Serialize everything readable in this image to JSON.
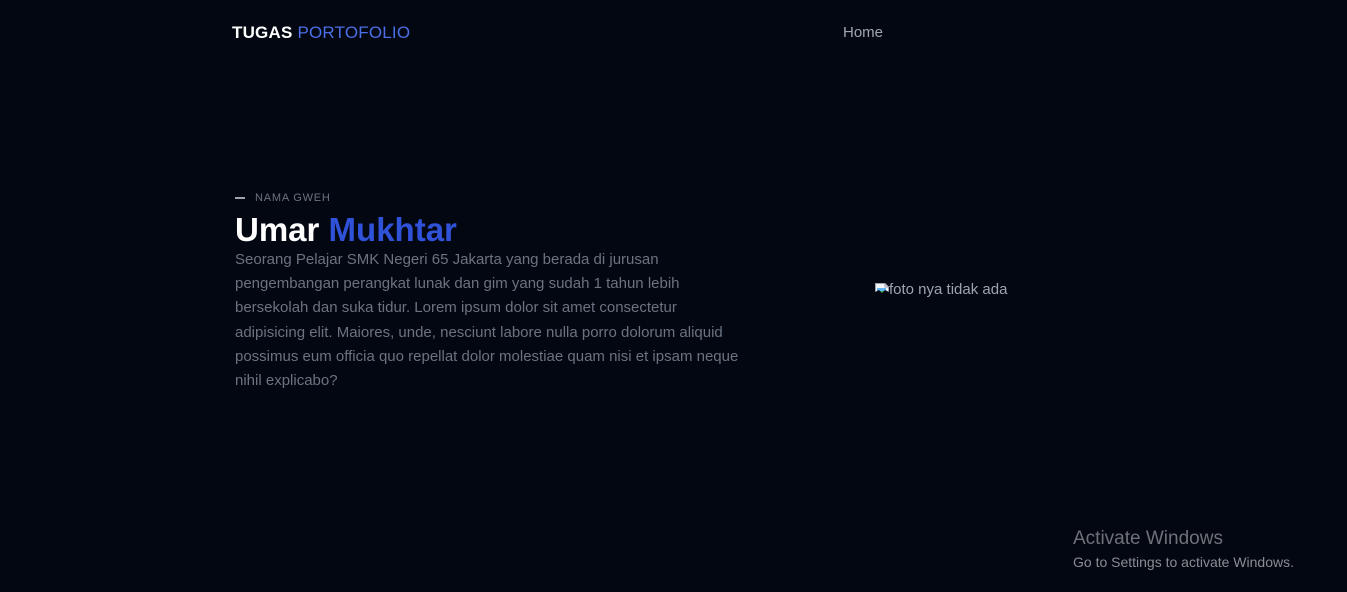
{
  "nav": {
    "brand_strong": "TUGAS",
    "brand_light": "PORTOFOLIO",
    "home_label": "Home"
  },
  "hero": {
    "eyebrow": "NAMA GWEH",
    "first_name": "Umar",
    "last_name": "Mukhtar",
    "description": "Seorang Pelajar SMK Negeri 65 Jakarta yang berada di jurusan pengembangan perangkat lunak dan gim yang sudah 1 tahun lebih bersekolah dan suka tidur. Lorem ipsum dolor sit amet consectetur adipisicing elit. Maiores, unde, nesciunt labore nulla porro dolorum aliquid possimus eum officia quo repellat dolor molestiae quam nisi et ipsam neque nihil explicabo?",
    "photo_alt": "foto nya tidak ada"
  },
  "watermark": {
    "title": "Activate Windows",
    "subtitle": "Go to Settings to activate Windows."
  },
  "colors": {
    "background": "#030712",
    "accent": "#2f52d9",
    "brand_accent": "#4b6fe6",
    "muted_text": "#6b7280"
  },
  "icons": {
    "photo": "broken-image-icon"
  }
}
